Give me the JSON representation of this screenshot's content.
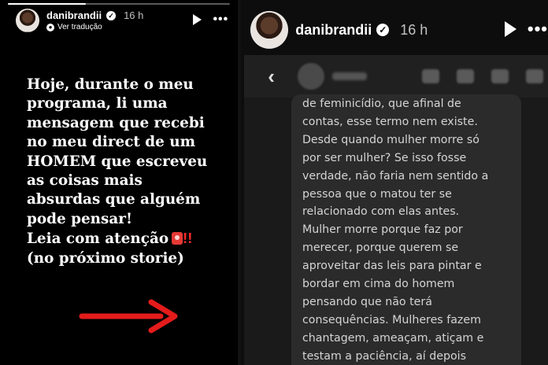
{
  "story_left": {
    "progress": 0.35,
    "user": {
      "username": "danibrandii",
      "verified_mark": "✓",
      "time": "16 h",
      "translation_link": "Ver tradução"
    },
    "icons": {
      "play": "play-icon",
      "more": "more-icon",
      "translate": "globe-icon",
      "siren": "police-light-emoji"
    },
    "more_glyph": "•••",
    "text_lines": [
      "Hoje, durante o meu",
      "programa, li uma",
      "mensagem que recebi",
      "no meu direct de um",
      "HOMEM que escreveu",
      "as coisas mais",
      "absurdas que alguém",
      "pode pensar!",
      "Leia com atenção"
    ],
    "exclamations": "!!",
    "last_line": "(no próximo storie)",
    "arrow_color": "#e31b1b"
  },
  "story_right": {
    "user": {
      "username": "danibrandii",
      "verified_mark": "✓",
      "time": "16 h"
    },
    "more_glyph": "•••",
    "back_glyph": "‹",
    "message_lines": [
      "de feminicídio, que afinal de",
      "contas, esse termo nem existe.",
      "Desde quando mulher morre só",
      "por ser mulher? Se isso fosse",
      "verdade, não faria nem sentido a",
      "pessoa que o matou ter se",
      "relacionado com elas antes.",
      "Mulher morre porque faz por",
      "merecer, porque querem se",
      "aproveitar das leis para pintar e",
      "bordar em cima do homem",
      "pensando que não terá",
      "consequências. Mulheres fazem",
      "chantagem, ameaçam, atiçam e",
      "testam a paciência, aí depois"
    ]
  }
}
